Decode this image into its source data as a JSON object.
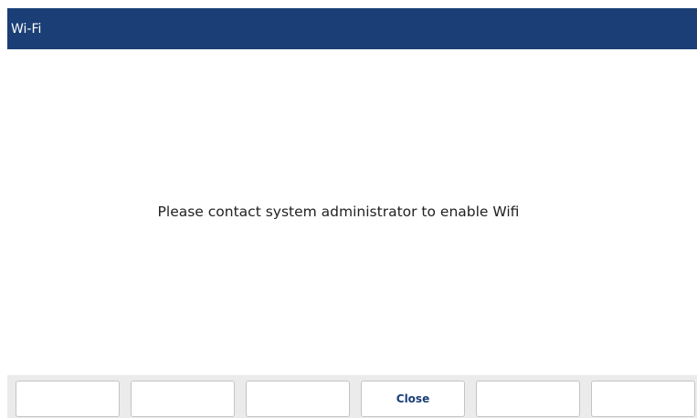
{
  "window": {
    "title": "Wi-Fi"
  },
  "main": {
    "message": "Please contact system administrator to enable Wifi"
  },
  "softkeys": [
    {
      "label": ""
    },
    {
      "label": ""
    },
    {
      "label": ""
    },
    {
      "label": "Close"
    },
    {
      "label": ""
    },
    {
      "label": ""
    }
  ],
  "colors": {
    "title_bar": "#1a3e75",
    "title_text": "#ffffff",
    "softkey_bar": "#ebebeb",
    "softkey_label": "#1a3e75"
  }
}
